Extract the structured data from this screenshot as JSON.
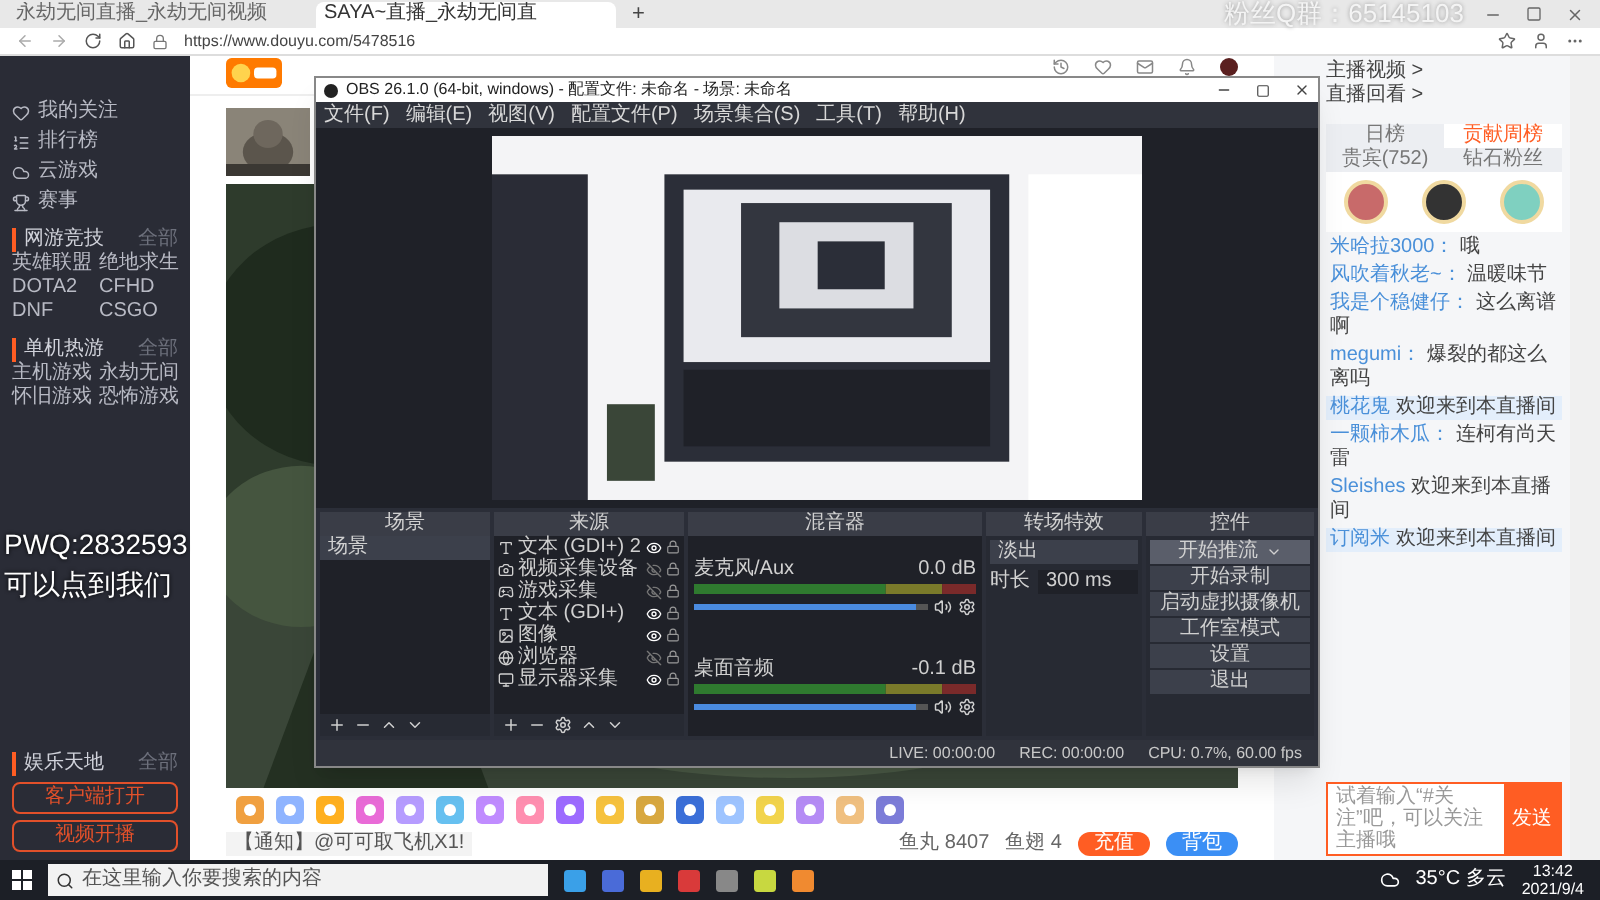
{
  "browser": {
    "tabs": [
      {
        "title": "永劫无间直播_永劫无间视频",
        "selected": false
      },
      {
        "title": "SAYA~直播_永劫无间直",
        "selected": true
      }
    ],
    "new_tab": "+",
    "url": "https://www.douyu.com/5478516"
  },
  "overlay": {
    "fan_group": "粉丝Q群：65145103",
    "pwq": "PWQ:2832593",
    "pwq_note": "可以点到我们"
  },
  "sidebar": {
    "nav": [
      "我的关注",
      "排行榜",
      "云游戏",
      "赛事"
    ],
    "sections": [
      {
        "title": "网游竞技",
        "more": "全部",
        "items": [
          "英雄联盟",
          "绝地求生",
          "DOTA2",
          "CFHD",
          "DNF",
          "CSGO"
        ]
      },
      {
        "title": "单机热游",
        "more": "全部",
        "items": [
          "主机游戏",
          "永劫无间",
          "怀旧游戏",
          "恐怖游戏"
        ]
      }
    ],
    "bottom_section": {
      "title": "娱乐天地",
      "more": "全部"
    },
    "buttons": [
      "客户端打开",
      "视频开播"
    ]
  },
  "obs": {
    "title": "OBS 26.1.0 (64-bit, windows) - 配置文件: 未命名 - 场景: 未命名",
    "menu": [
      "文件(F)",
      "编辑(E)",
      "视图(V)",
      "配置文件(P)",
      "场景集合(S)",
      "工具(T)",
      "帮助(H)"
    ],
    "docks": {
      "scenes": "场景",
      "sources": "来源",
      "mixer": "混音器",
      "transitions": "转场特效",
      "controls": "控件"
    },
    "scenes": [
      {
        "name": "场景",
        "selected": true
      }
    ],
    "sources": [
      {
        "name": "文本 (GDI+) 2",
        "kind": "text",
        "visible": true
      },
      {
        "name": "视频采集设备",
        "kind": "camera",
        "visible": false
      },
      {
        "name": "游戏采集",
        "kind": "game",
        "visible": false
      },
      {
        "name": "文本 (GDI+)",
        "kind": "text",
        "visible": true
      },
      {
        "name": "图像",
        "visible": true
      },
      {
        "name": "浏览器",
        "kind": "browser",
        "visible": false
      },
      {
        "name": "显示器采集",
        "kind": "monitor",
        "visible": true
      }
    ],
    "mixer": [
      {
        "name": "麦克风/Aux",
        "reading": "0.0 dB",
        "level": 0.95
      },
      {
        "name": "桌面音频",
        "reading": "-0.1 dB",
        "level": 0.95
      }
    ],
    "transition": {
      "value": "淡出",
      "duration_label": "时长",
      "duration": "300 ms"
    },
    "controls": [
      {
        "label": "开始推流",
        "kind": "split"
      },
      {
        "label": "开始录制",
        "kind": "plain"
      },
      {
        "label": "启动虚拟摄像机",
        "kind": "plain"
      },
      {
        "label": "工作室模式",
        "kind": "plain"
      },
      {
        "label": "设置",
        "kind": "plain"
      },
      {
        "label": "退出",
        "kind": "plain"
      }
    ],
    "status": [
      "LIVE: 00:00:00",
      "REC: 00:00:00",
      "CPU: 0.7%, 60.00 fps"
    ]
  },
  "room": {
    "notice": "【通知】@可可取飞机X1!",
    "stats": [
      {
        "label": "鱼丸 8407"
      },
      {
        "label": "鱼翅 4"
      }
    ],
    "recharge": "充值",
    "backpack": "背包"
  },
  "chat": {
    "links": [
      "主播视频 >",
      "直播回看 >"
    ],
    "tabs": [
      {
        "label": "日榜",
        "selected": false
      },
      {
        "label": "贡献周榜",
        "selected": true
      },
      {
        "label": "贵宾(752)",
        "selected": false
      },
      {
        "label": "钻石粉丝",
        "selected": false
      }
    ],
    "messages": [
      {
        "user": "米哈拉3000：",
        "text": "哦",
        "selected": false
      },
      {
        "user": "风吹着秋老~：",
        "text": "温暖味节",
        "selected": false
      },
      {
        "user": "我是个稳健仔：",
        "text": "这么离谱啊",
        "selected": false
      },
      {
        "user": "megumi：",
        "text": "爆裂的都这么离吗",
        "selected": false
      },
      {
        "user": "桃花鬼",
        "text": "欢迎来到本直播间",
        "selected": true
      },
      {
        "user": "一颗柿木瓜：",
        "text": "连柯有尚天雷",
        "selected": false
      },
      {
        "user": "Sleishes",
        "text": "欢迎来到本直播间",
        "selected": false
      },
      {
        "user": "订阅米",
        "text": "欢迎来到本直播间",
        "selected": true
      }
    ],
    "input_placeholder": "试着输入“#关注”吧，可以关注主播哦",
    "send": "发送"
  },
  "taskbar": {
    "search_placeholder": "在这里输入你要搜索的内容",
    "weather": "35°C 多云",
    "time": "13:42",
    "date": "2021/9/4"
  }
}
